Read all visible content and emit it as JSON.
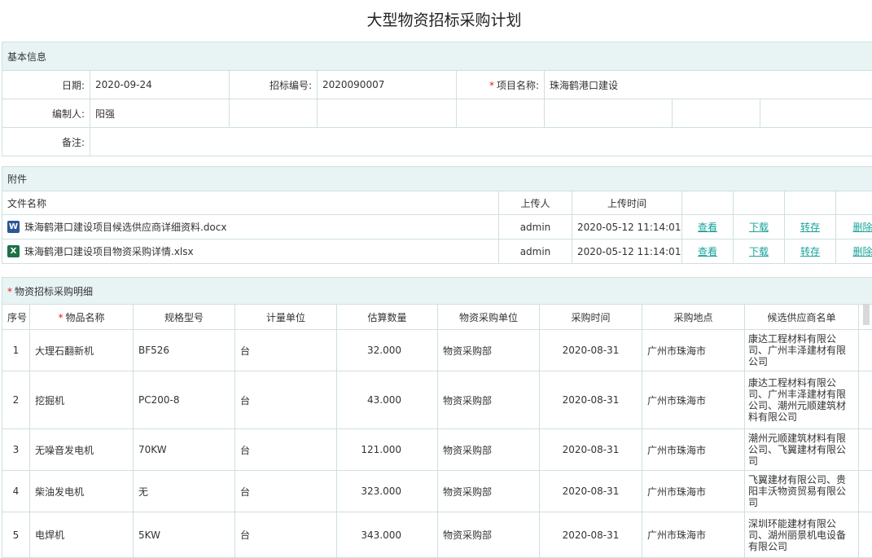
{
  "page_title": "大型物资招标采购计划",
  "basic": {
    "header": "基本信息",
    "date_label": "日期:",
    "date_value": "2020-09-24",
    "bid_no_label": "招标编号:",
    "bid_no_value": "2020090007",
    "project_label": "项目名称:",
    "project_value": "珠海鹤港口建设",
    "compiler_label": "编制人:",
    "compiler_value": "阳强",
    "remark_label": "备注:",
    "required_mark": "*"
  },
  "attachments": {
    "header": "附件",
    "columns": [
      "文件名称",
      "上传人",
      "上传时间"
    ],
    "files": [
      {
        "name": "珠海鹤港口建设项目候选供应商详细资料.docx",
        "icon": "word-icon",
        "uploader": "admin",
        "time": "2020-05-12 11:14:01"
      },
      {
        "name": "珠海鹤港口建设项目物资采购详情.xlsx",
        "icon": "excel-icon",
        "uploader": "admin",
        "time": "2020-05-12 11:14:01"
      }
    ],
    "actions": {
      "view": "查看",
      "download": "下载",
      "transfer": "转存",
      "delete": "删除"
    }
  },
  "details": {
    "header": "物资招标采购明细",
    "required_mark": "*",
    "columns": [
      "序号",
      "物品名称",
      "规格型号",
      "计量单位",
      "估算数量",
      "物资采购单位",
      "采购时间",
      "采购地点",
      "候选供应商名单"
    ],
    "rows": [
      {
        "no": "1",
        "name": "大理石翻新机",
        "spec": "BF526",
        "unit": "台",
        "qty": "32.000",
        "dept": "物资采购部",
        "date": "2020-08-31",
        "place": "广州市珠海市",
        "suppliers": "康达工程材料有限公司、广州丰泽建材有限公司"
      },
      {
        "no": "2",
        "name": "挖掘机",
        "spec": "PC200-8",
        "unit": "台",
        "qty": "43.000",
        "dept": "物资采购部",
        "date": "2020-08-31",
        "place": "广州市珠海市",
        "suppliers": "康达工程材料有限公司、广州丰泽建材有限公司、潮州元顺建筑材料有限公司"
      },
      {
        "no": "3",
        "name": "无噪音发电机",
        "spec": "70KW",
        "unit": "台",
        "qty": "121.000",
        "dept": "物资采购部",
        "date": "2020-08-31",
        "place": "广州市珠海市",
        "suppliers": "潮州元顺建筑材料有限公司、飞翼建材有限公司"
      },
      {
        "no": "4",
        "name": "柴油发电机",
        "spec": "无",
        "unit": "台",
        "qty": "323.000",
        "dept": "物资采购部",
        "date": "2020-08-31",
        "place": "广州市珠海市",
        "suppliers": "飞翼建材有限公司、贵阳丰沃物资贸易有限公司"
      },
      {
        "no": "5",
        "name": "电焊机",
        "spec": "5KW",
        "unit": "台",
        "qty": "343.000",
        "dept": "物资采购部",
        "date": "2020-08-31",
        "place": "广州市珠海市",
        "suppliers": "深圳环能建材有限公司、湖州丽景机电设备有限公司"
      }
    ]
  },
  "colors": {
    "accent": "#1aa39a",
    "header_bg": "#e8f4f4",
    "border": "#cfdfe0",
    "required": "#e02020"
  }
}
